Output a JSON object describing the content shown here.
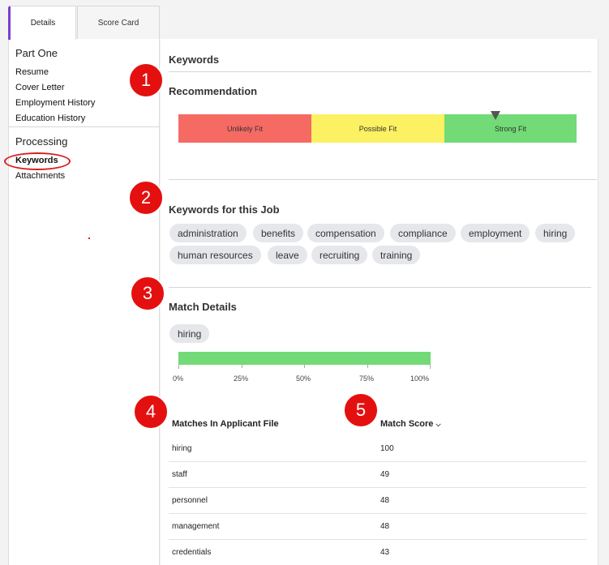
{
  "tabs": {
    "details": "Details",
    "score_card": "Score Card"
  },
  "sidebar": {
    "part_one": "Part One",
    "part_one_items": [
      "Resume",
      "Cover Letter",
      "Employment History",
      "Education History"
    ],
    "processing": "Processing",
    "processing_items": [
      "Keywords",
      "Attachments"
    ]
  },
  "main": {
    "title": "Keywords",
    "recommendation": {
      "heading": "Recommendation",
      "segments": [
        "Unlikely Fit",
        "Possible Fit",
        "Strong Fit"
      ],
      "selected": "Strong Fit"
    },
    "keywords": {
      "heading": "Keywords for this Job",
      "chips": [
        "administration",
        "benefits",
        "compensation",
        "compliance",
        "employment",
        "hiring",
        "human resources",
        "leave",
        "recruiting",
        "training"
      ]
    },
    "match_details": {
      "heading": "Match Details",
      "selected_chip": "hiring",
      "progress_percent": 100,
      "ticks": [
        "0%",
        "25%",
        "50%",
        "75%",
        "100%"
      ]
    },
    "matches_table": {
      "col_matches": "Matches In Applicant File",
      "col_score": "Match Score",
      "sort_icon": "chevron-down-icon",
      "rows": [
        {
          "term": "hiring",
          "score": "100"
        },
        {
          "term": "staff",
          "score": "49"
        },
        {
          "term": "personnel",
          "score": "48"
        },
        {
          "term": "management",
          "score": "48"
        },
        {
          "term": "credentials",
          "score": "43"
        }
      ]
    }
  },
  "callouts": [
    "1",
    "2",
    "3",
    "4",
    "5"
  ],
  "colors": {
    "accent": "#7c3fd0",
    "unlikely": "#f66a64",
    "possible": "#fcf162",
    "strong": "#72da76",
    "callout": "#e4100f"
  }
}
